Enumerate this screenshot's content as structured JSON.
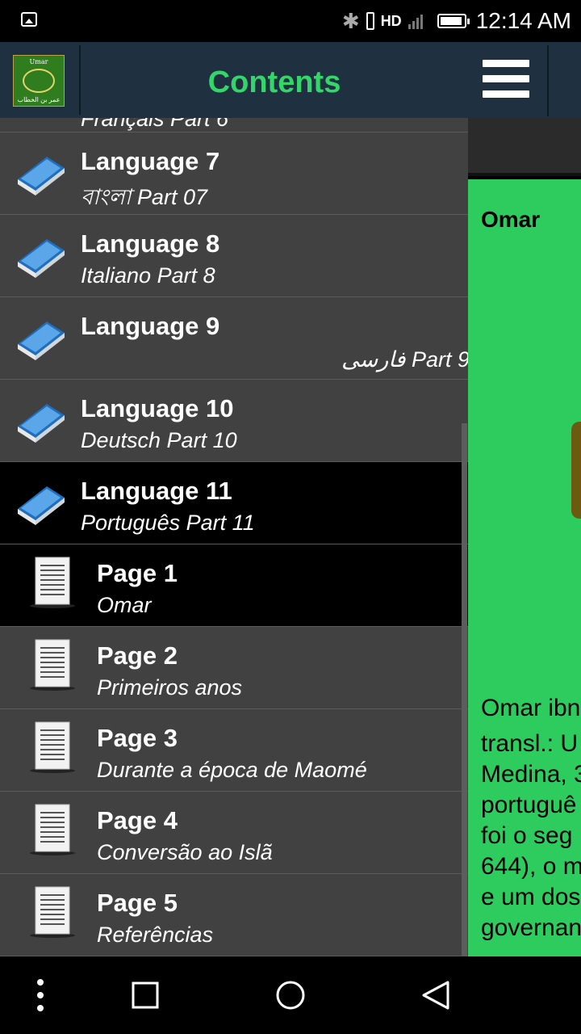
{
  "status_bar": {
    "network": "HD",
    "time": "12:14 AM"
  },
  "drawer": {
    "title": "Contents",
    "logo_top_text": "Umar",
    "logo_bottom_text": "عمر بن الخطاب",
    "partial_item_subtitle": "Français Part 6",
    "items": [
      {
        "title": "Language 7",
        "subtitle": "বাংলা Part 07",
        "type": "language"
      },
      {
        "title": "Language 8",
        "subtitle": "Italiano Part 8",
        "type": "language"
      },
      {
        "title": "Language 9",
        "subtitle": "فارسی Part 9",
        "type": "language",
        "rtl": true
      },
      {
        "title": "Language 10",
        "subtitle": "Deutsch Part 10",
        "type": "language"
      },
      {
        "title": "Language 11",
        "subtitle": "Português Part 11",
        "type": "language",
        "selected": true
      },
      {
        "title": "Page 1",
        "subtitle": "Omar",
        "type": "page",
        "selected": true
      },
      {
        "title": "Page 2",
        "subtitle": "Primeiros anos",
        "type": "page"
      },
      {
        "title": "Page 3",
        "subtitle": "Durante a época de Maomé",
        "type": "page"
      },
      {
        "title": "Page 4",
        "subtitle": "Conversão ao Islã",
        "type": "page"
      },
      {
        "title": "Page 5",
        "subtitle": "Referências",
        "type": "page"
      }
    ]
  },
  "main": {
    "article_title": "Omar",
    "text_lines": [
      "Omar ibn",
      "transl.: U",
      "Medina, 3",
      "portuguê",
      "foi o seg",
      "644), o m",
      "e um dos",
      "governan"
    ]
  },
  "colors": {
    "accent_green": "#34d66a",
    "header_bg": "#1f3140",
    "drawer_bg": "#414141",
    "panel_green": "#2ecc5f"
  }
}
